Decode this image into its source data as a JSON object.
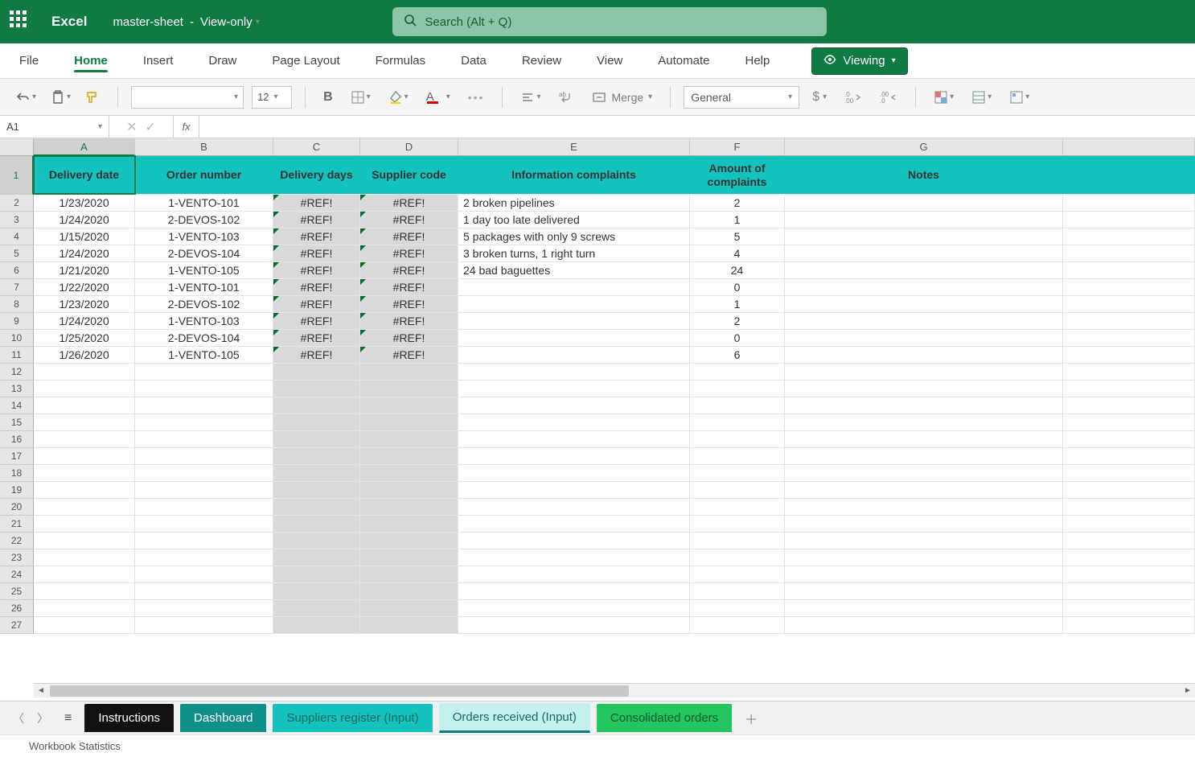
{
  "app": {
    "name": "Excel",
    "doc": "master-sheet",
    "mode": "View-only"
  },
  "search": {
    "placeholder": "Search (Alt + Q)"
  },
  "tabs": {
    "file": "File",
    "home": "Home",
    "insert": "Insert",
    "draw": "Draw",
    "page_layout": "Page Layout",
    "formulas": "Formulas",
    "data": "Data",
    "review": "Review",
    "view": "View",
    "automate": "Automate",
    "help": "Help",
    "viewing": "Viewing"
  },
  "toolbar": {
    "font_size": "12",
    "merge": "Merge",
    "number_format": "General"
  },
  "namebox": "A1",
  "columns": [
    "A",
    "B",
    "C",
    "D",
    "E",
    "F",
    "G"
  ],
  "headers": {
    "a": "Delivery date",
    "b": "Order number",
    "c": "Delivery days",
    "d": "Supplier code",
    "e": "Information complaints",
    "f": "Amount of complaints",
    "g": "Notes"
  },
  "rows": [
    {
      "a": "1/23/2020",
      "b": "1-VENTO-101",
      "c": "#REF!",
      "d": "#REF!",
      "e": "2 broken pipelines",
      "f": "2"
    },
    {
      "a": "1/24/2020",
      "b": "2-DEVOS-102",
      "c": "#REF!",
      "d": "#REF!",
      "e": "1 day too late delivered",
      "f": "1"
    },
    {
      "a": "1/15/2020",
      "b": "1-VENTO-103",
      "c": "#REF!",
      "d": "#REF!",
      "e": "5 packages with only 9 screws",
      "f": "5"
    },
    {
      "a": "1/24/2020",
      "b": "2-DEVOS-104",
      "c": "#REF!",
      "d": "#REF!",
      "e": "3 broken turns, 1 right turn",
      "f": "4"
    },
    {
      "a": "1/21/2020",
      "b": "1-VENTO-105",
      "c": "#REF!",
      "d": "#REF!",
      "e": "24 bad baguettes",
      "f": "24"
    },
    {
      "a": "1/22/2020",
      "b": "1-VENTO-101",
      "c": "#REF!",
      "d": "#REF!",
      "e": "",
      "f": "0"
    },
    {
      "a": "1/23/2020",
      "b": "2-DEVOS-102",
      "c": "#REF!",
      "d": "#REF!",
      "e": "",
      "f": "1"
    },
    {
      "a": "1/24/2020",
      "b": "1-VENTO-103",
      "c": "#REF!",
      "d": "#REF!",
      "e": "",
      "f": "2"
    },
    {
      "a": "1/25/2020",
      "b": "2-DEVOS-104",
      "c": "#REF!",
      "d": "#REF!",
      "e": "",
      "f": "0"
    },
    {
      "a": "1/26/2020",
      "b": "1-VENTO-105",
      "c": "#REF!",
      "d": "#REF!",
      "e": "",
      "f": "6"
    }
  ],
  "sheets": {
    "instructions": "Instructions",
    "dashboard": "Dashboard",
    "suppliers": "Suppliers register (Input)",
    "orders": "Orders received (Input)",
    "consolidated": "Consolidated orders"
  },
  "status": "Workbook Statistics"
}
